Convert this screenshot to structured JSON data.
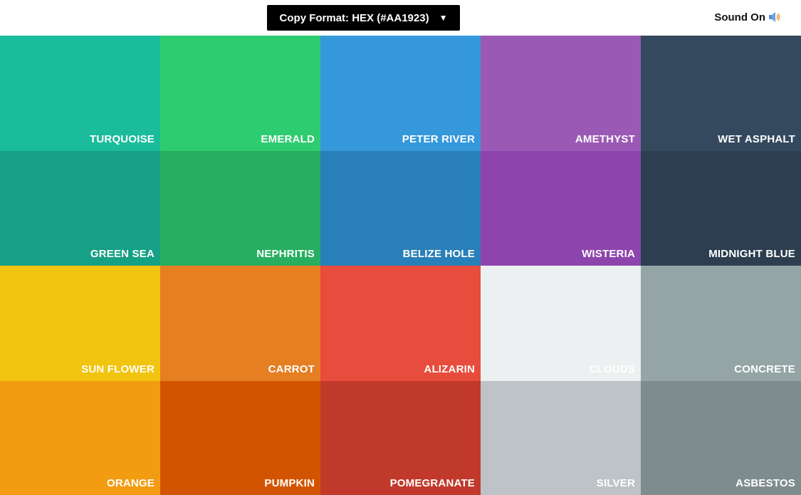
{
  "header": {
    "format_button_label": "Copy Format: HEX (#AA1923)",
    "format_arrow": "▼",
    "sound_label": "Sound On",
    "sound_icon": "speaker-icon"
  },
  "swatches": [
    {
      "name": "TURQUOISE",
      "color": "#1abc9c",
      "label_color": "#ffffff"
    },
    {
      "name": "EMERALD",
      "color": "#2ecc71",
      "label_color": "#ffffff"
    },
    {
      "name": "PETER RIVER",
      "color": "#3498db",
      "label_color": "#ffffff"
    },
    {
      "name": "AMETHYST",
      "color": "#9b59b6",
      "label_color": "#ffffff"
    },
    {
      "name": "WET ASPHALT",
      "color": "#34495e",
      "label_color": "#ffffff"
    },
    {
      "name": "GREEN SEA",
      "color": "#16a085",
      "label_color": "#ffffff"
    },
    {
      "name": "NEPHRITIS",
      "color": "#27ae60",
      "label_color": "#ffffff"
    },
    {
      "name": "BELIZE HOLE",
      "color": "#2980b9",
      "label_color": "#ffffff"
    },
    {
      "name": "WISTERIA",
      "color": "#8e44ad",
      "label_color": "#ffffff"
    },
    {
      "name": "MIDNIGHT BLUE",
      "color": "#2c3e50",
      "label_color": "#ffffff"
    },
    {
      "name": "SUN FLOWER",
      "color": "#f1c40f",
      "label_color": "#ffffff"
    },
    {
      "name": "CARROT",
      "color": "#e67e22",
      "label_color": "#ffffff"
    },
    {
      "name": "ALIZARIN",
      "color": "#e74c3c",
      "label_color": "#ffffff"
    },
    {
      "name": "CLOUDS",
      "color": "#ecf0f1",
      "label_color": "#ffffff"
    },
    {
      "name": "CONCRETE",
      "color": "#95a5a6",
      "label_color": "#ffffff"
    },
    {
      "name": "ORANGE",
      "color": "#f39c12",
      "label_color": "#ffffff"
    },
    {
      "name": "PUMPKIN",
      "color": "#d35400",
      "label_color": "#ffffff"
    },
    {
      "name": "POMEGRANATE",
      "color": "#c0392b",
      "label_color": "#ffffff"
    },
    {
      "name": "SILVER",
      "color": "#bdc3c7",
      "label_color": "#ffffff"
    },
    {
      "name": "ASBESTOS",
      "color": "#7f8c8d",
      "label_color": "#ffffff"
    }
  ]
}
